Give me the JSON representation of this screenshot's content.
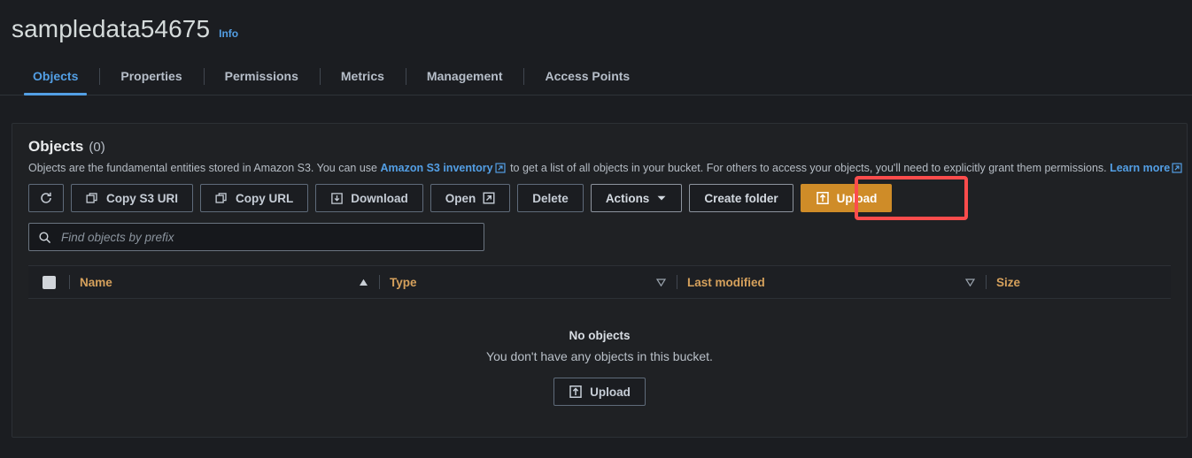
{
  "header": {
    "bucket_name": "sampledata54675",
    "info_label": "Info"
  },
  "tabs": [
    {
      "label": "Objects",
      "active": true
    },
    {
      "label": "Properties",
      "active": false
    },
    {
      "label": "Permissions",
      "active": false
    },
    {
      "label": "Metrics",
      "active": false
    },
    {
      "label": "Management",
      "active": false
    },
    {
      "label": "Access Points",
      "active": false
    }
  ],
  "objects_panel": {
    "title": "Objects",
    "count": "(0)",
    "description_part1": "Objects are the fundamental entities stored in Amazon S3. You can use ",
    "inventory_link": "Amazon S3 inventory",
    "description_part2": " to get a list of all objects in your bucket. For others to access your objects, you'll need to explicitly grant them permissions. ",
    "learn_more_link": "Learn more"
  },
  "toolbar": {
    "refresh_icon": "refresh-icon",
    "copy_s3_uri_label": "Copy S3 URI",
    "copy_url_label": "Copy URL",
    "download_label": "Download",
    "open_label": "Open",
    "delete_label": "Delete",
    "actions_label": "Actions",
    "create_folder_label": "Create folder",
    "upload_label": "Upload"
  },
  "search": {
    "placeholder": "Find objects by prefix",
    "value": ""
  },
  "table": {
    "columns": [
      {
        "label": "Name",
        "sort": "asc"
      },
      {
        "label": "Type",
        "sort": "none"
      },
      {
        "label": "Last modified",
        "sort": "none"
      },
      {
        "label": "Size",
        "sort": "none"
      }
    ],
    "rows": []
  },
  "empty_state": {
    "title": "No objects",
    "subtitle": "You don't have any objects in this bucket.",
    "upload_label": "Upload"
  },
  "colors": {
    "accent_blue": "#539fe5",
    "accent_orange": "#cf8c28",
    "highlight_red": "#fc4c4c",
    "column_header": "#d6a15c",
    "page_background": "#1b1d21",
    "panel_background": "#1f2124"
  }
}
